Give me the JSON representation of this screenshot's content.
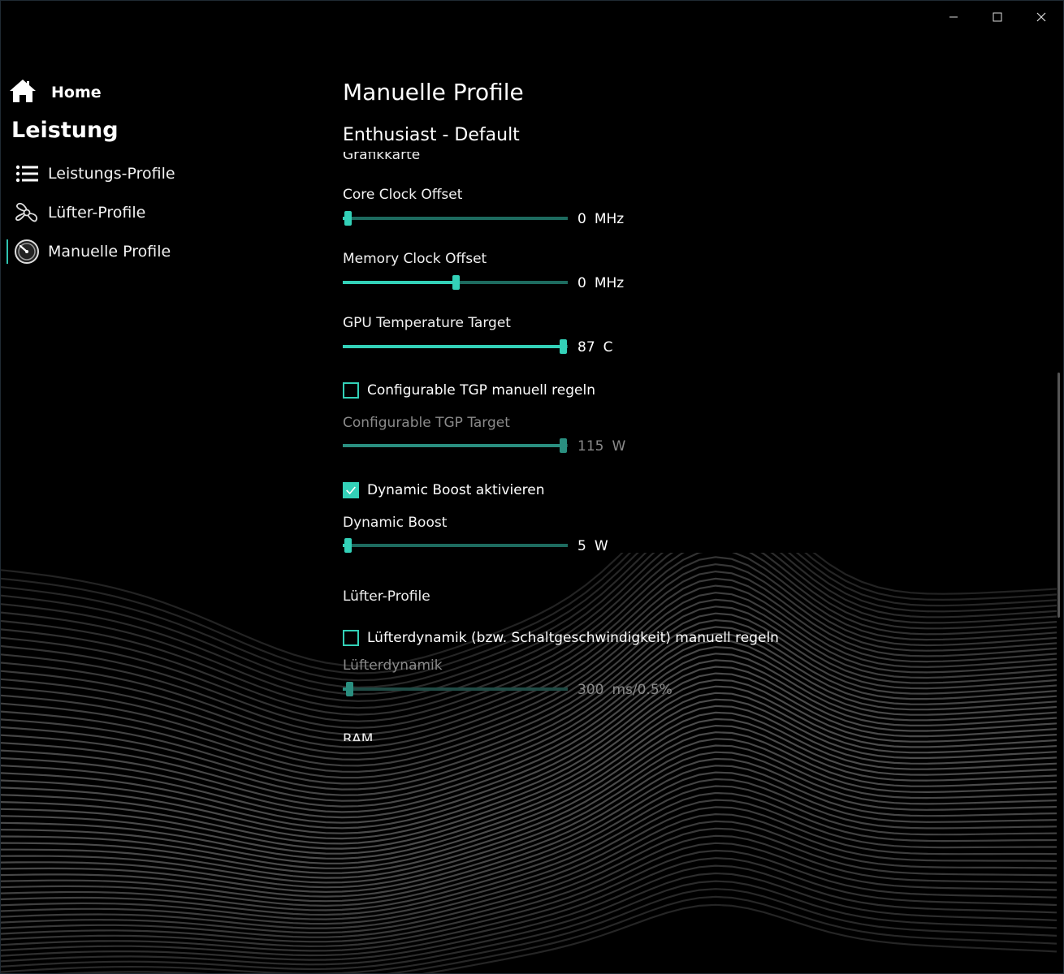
{
  "sidebar": {
    "home_label": "Home",
    "section_title": "Leistung",
    "items": [
      {
        "label": "Leistungs-Profile",
        "icon": "list-icon"
      },
      {
        "label": "Lüfter-Profile",
        "icon": "fan-icon"
      },
      {
        "label": "Manuelle Profile",
        "icon": "gauge-icon"
      }
    ]
  },
  "main": {
    "title": "Manuelle Profile",
    "profile_name": "Enthusiast - Default",
    "gpu_group": "Grafikkarte",
    "core_clock": {
      "label": "Core Clock Offset",
      "value": "0",
      "unit": "MHz",
      "fraction": 0.02
    },
    "memory_clock": {
      "label": "Memory Clock Offset",
      "value": "0",
      "unit": "MHz",
      "fraction": 0.5
    },
    "gpu_temp": {
      "label": "GPU Temperature Target",
      "value": "87",
      "unit": "C",
      "fraction": 0.98
    },
    "tgp_checkbox": {
      "label": "Configurable TGP manuell regeln",
      "checked": false
    },
    "tgp_target": {
      "label": "Configurable TGP Target",
      "value": "115",
      "unit": "W",
      "fraction": 0.98
    },
    "dynamic_boost_checkbox": {
      "label": "Dynamic Boost aktivieren",
      "checked": true
    },
    "dynamic_boost": {
      "label": "Dynamic Boost",
      "value": "5",
      "unit": "W",
      "fraction": 0.02
    },
    "fan_group": "Lüfter-Profile",
    "fan_checkbox": {
      "label": "Lüfterdynamik (bzw. Schaltgeschwindigkeit) manuell regeln",
      "checked": false
    },
    "fan_dynamics": {
      "label": "Lüfterdynamik",
      "value": "300",
      "unit": "ms/0.5%",
      "fraction": 0.03
    },
    "ram_group": "RAM"
  },
  "colors": {
    "accent": "#33d1b8",
    "accent_dark": "#1d6b5f",
    "background": "#000000"
  }
}
